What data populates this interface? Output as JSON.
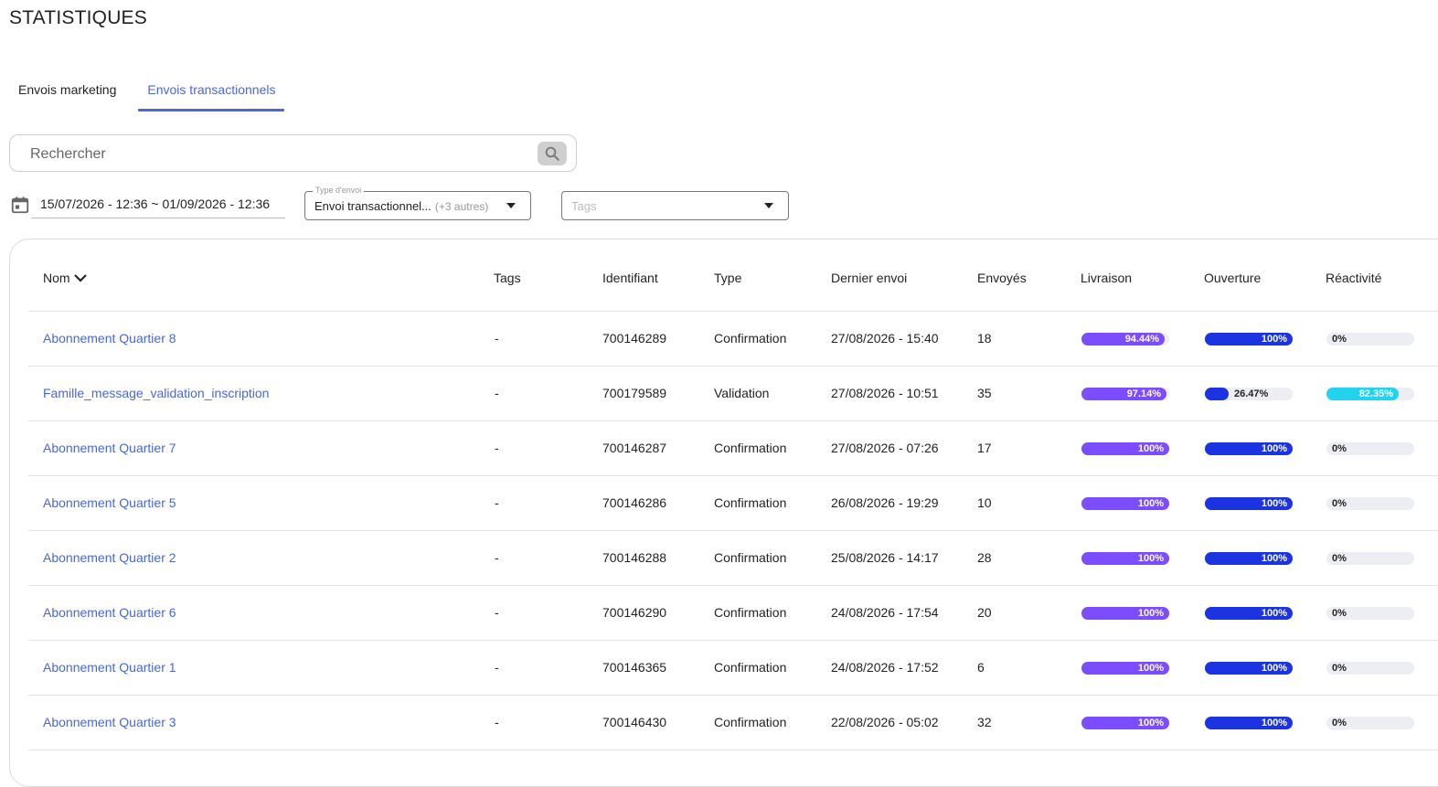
{
  "page": {
    "title": "STATISTIQUES"
  },
  "tabs": [
    {
      "label": "Envois marketing",
      "active": false
    },
    {
      "label": "Envois transactionnels",
      "active": true
    }
  ],
  "search": {
    "placeholder": "Rechercher",
    "icon": "search-icon"
  },
  "filters": {
    "date_range": "15/07/2026 - 12:36 ~ 01/09/2026 - 12:36",
    "date_icon": "calendar-icon",
    "type_label": "Type d'envoi",
    "type_value": "Envoi transactionnel...",
    "type_extra": "(+3 autres)",
    "tags_placeholder": "Tags"
  },
  "colors": {
    "accent": "#4a67d6",
    "livraison": "#7c4dff",
    "ouverture": "#1b33e0",
    "reactivite": "#22d3ee"
  },
  "table": {
    "columns": {
      "nom": "Nom",
      "tags": "Tags",
      "identifiant": "Identifiant",
      "type": "Type",
      "dernier_envoi": "Dernier envoi",
      "envoyes": "Envoyés",
      "livraison": "Livraison",
      "ouverture": "Ouverture",
      "reactivite": "Réactivité"
    },
    "rows": [
      {
        "nom": "Abonnement Quartier 8",
        "tags": "-",
        "identifiant": "700146289",
        "type": "Confirmation",
        "dernier_envoi": "27/08/2026 - 15:40",
        "envoyes": "18",
        "livraison": {
          "text": "94.44%",
          "value": 94.44
        },
        "ouverture": {
          "text": "100%",
          "value": 100
        },
        "reactivite": {
          "text": "0%",
          "value": 0
        }
      },
      {
        "nom": "Famille_message_validation_inscription",
        "tags": "-",
        "identifiant": "700179589",
        "type": "Validation",
        "dernier_envoi": "27/08/2026 - 10:51",
        "envoyes": "35",
        "livraison": {
          "text": "97.14%",
          "value": 97.14
        },
        "ouverture": {
          "text": "26.47%",
          "value": 26.47
        },
        "reactivite": {
          "text": "82.35%",
          "value": 82.35
        }
      },
      {
        "nom": "Abonnement Quartier 7",
        "tags": "-",
        "identifiant": "700146287",
        "type": "Confirmation",
        "dernier_envoi": "27/08/2026 - 07:26",
        "envoyes": "17",
        "livraison": {
          "text": "100%",
          "value": 100
        },
        "ouverture": {
          "text": "100%",
          "value": 100
        },
        "reactivite": {
          "text": "0%",
          "value": 0
        }
      },
      {
        "nom": "Abonnement Quartier 5",
        "tags": "-",
        "identifiant": "700146286",
        "type": "Confirmation",
        "dernier_envoi": "26/08/2026 - 19:29",
        "envoyes": "10",
        "livraison": {
          "text": "100%",
          "value": 100
        },
        "ouverture": {
          "text": "100%",
          "value": 100
        },
        "reactivite": {
          "text": "0%",
          "value": 0
        }
      },
      {
        "nom": "Abonnement Quartier 2",
        "tags": "-",
        "identifiant": "700146288",
        "type": "Confirmation",
        "dernier_envoi": "25/08/2026 - 14:17",
        "envoyes": "28",
        "livraison": {
          "text": "100%",
          "value": 100
        },
        "ouverture": {
          "text": "100%",
          "value": 100
        },
        "reactivite": {
          "text": "0%",
          "value": 0
        }
      },
      {
        "nom": "Abonnement Quartier 6",
        "tags": "-",
        "identifiant": "700146290",
        "type": "Confirmation",
        "dernier_envoi": "24/08/2026 - 17:54",
        "envoyes": "20",
        "livraison": {
          "text": "100%",
          "value": 100
        },
        "ouverture": {
          "text": "100%",
          "value": 100
        },
        "reactivite": {
          "text": "0%",
          "value": 0
        }
      },
      {
        "nom": "Abonnement Quartier 1",
        "tags": "-",
        "identifiant": "700146365",
        "type": "Confirmation",
        "dernier_envoi": "24/08/2026 - 17:52",
        "envoyes": "6",
        "livraison": {
          "text": "100%",
          "value": 100
        },
        "ouverture": {
          "text": "100%",
          "value": 100
        },
        "reactivite": {
          "text": "0%",
          "value": 0
        }
      },
      {
        "nom": "Abonnement Quartier 3",
        "tags": "-",
        "identifiant": "700146430",
        "type": "Confirmation",
        "dernier_envoi": "22/08/2026 - 05:02",
        "envoyes": "32",
        "livraison": {
          "text": "100%",
          "value": 100
        },
        "ouverture": {
          "text": "100%",
          "value": 100
        },
        "reactivite": {
          "text": "0%",
          "value": 0
        }
      }
    ]
  }
}
